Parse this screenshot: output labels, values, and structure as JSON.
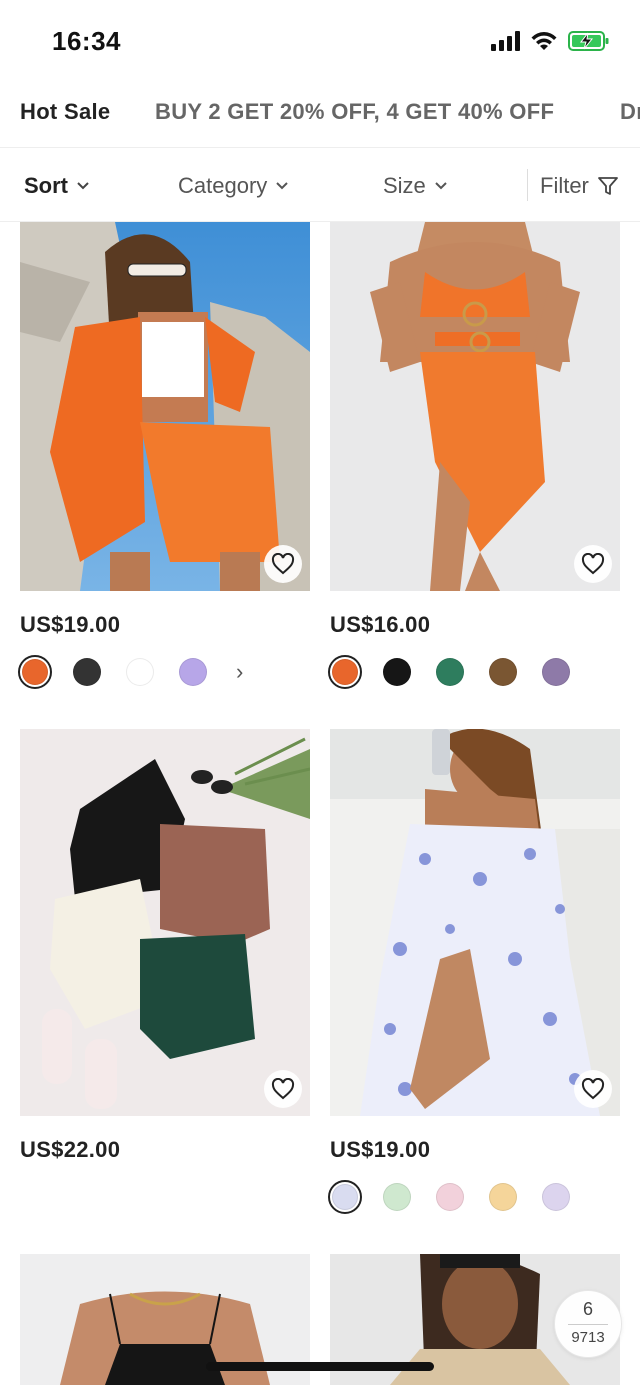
{
  "status_bar": {
    "time": "16:34"
  },
  "promo_tabs": [
    {
      "label": "Hot Sale"
    },
    {
      "label": "BUY 2 GET 20% OFF,  4 GET 40% OFF"
    },
    {
      "label": "Dr"
    }
  ],
  "filters": {
    "sort": "Sort",
    "category": "Category",
    "size": "Size",
    "filter": "Filter"
  },
  "products": [
    {
      "price": "US$19.00",
      "swatches": [
        "#e8662c",
        "#333333",
        "#ffffff",
        "#b7a6e8"
      ],
      "selected": 0,
      "has_more": true,
      "more_glyph": "›"
    },
    {
      "price": "US$16.00",
      "swatches": [
        "#e8662c",
        "#161616",
        "#2e7d5e",
        "#7a5632",
        "#8e7aa8"
      ],
      "selected": 0,
      "has_more": false
    },
    {
      "price": "US$22.00",
      "swatches": [],
      "has_more": false
    },
    {
      "price": "US$19.00",
      "swatches": [
        "#d9dcf0",
        "#cfe8cf",
        "#f2d1db",
        "#f5d59a",
        "#dcd4ee"
      ],
      "selected": 0,
      "has_more": false
    },
    {
      "price": "",
      "swatches": []
    },
    {
      "price": "",
      "swatches": []
    }
  ],
  "page_counter": {
    "current": "6",
    "total": "9713"
  },
  "colors": {
    "accent_orange": "#f07a2e",
    "text_dark": "#222222",
    "text_muted": "#666666"
  }
}
